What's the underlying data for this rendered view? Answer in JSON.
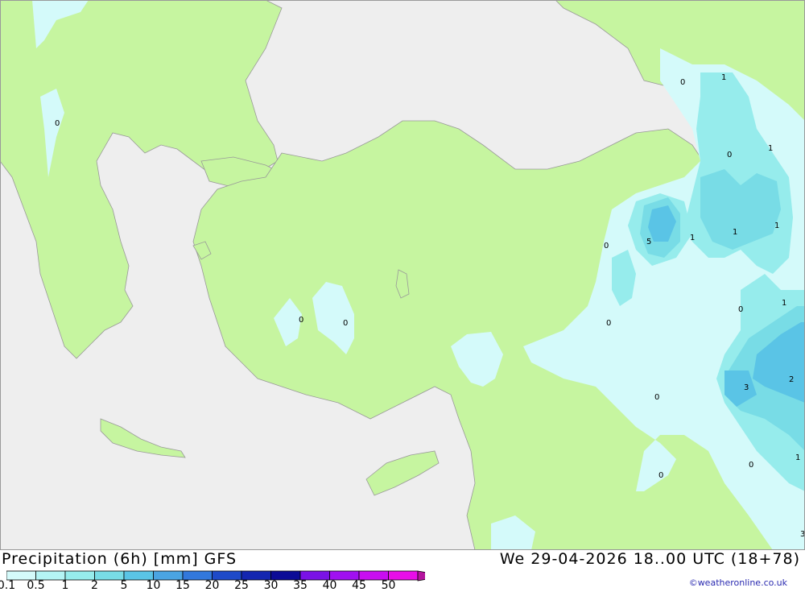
{
  "map": {
    "value_labels": [
      {
        "text": "0"
      },
      {
        "text": "0"
      },
      {
        "text": "1"
      },
      {
        "text": "0"
      },
      {
        "text": "1"
      },
      {
        "text": "0"
      },
      {
        "text": "5"
      },
      {
        "text": "1"
      },
      {
        "text": "1"
      },
      {
        "text": "1"
      },
      {
        "text": "0"
      },
      {
        "text": "0"
      },
      {
        "text": "0"
      },
      {
        "text": "0"
      },
      {
        "text": "1"
      },
      {
        "text": "2"
      },
      {
        "text": "3"
      },
      {
        "text": "0"
      },
      {
        "text": "0"
      },
      {
        "text": "0"
      },
      {
        "text": "1"
      },
      {
        "text": "3"
      }
    ]
  },
  "footer": {
    "title": "Precipitation (6h) [mm] GFS",
    "datetime": "We 29-04-2026 18..00 UTC (18+78)",
    "credit": "weatheronline.co.uk",
    "credit_icon": "copyright-icon"
  },
  "legend": {
    "colors": [
      "#d4fafa",
      "#b4f4f4",
      "#96ecec",
      "#78dce6",
      "#5ac4e6",
      "#4aa4e2",
      "#3278dc",
      "#1e4ac8",
      "#1426b0",
      "#0c0c96",
      "#7a12e6",
      "#a010f0",
      "#c80ef0",
      "#e80ee8",
      "#b4149e"
    ],
    "labels": [
      "0.1",
      "0.5",
      "1",
      "2",
      "5",
      "10",
      "15",
      "20",
      "25",
      "30",
      "35",
      "40",
      "45",
      "50"
    ]
  }
}
